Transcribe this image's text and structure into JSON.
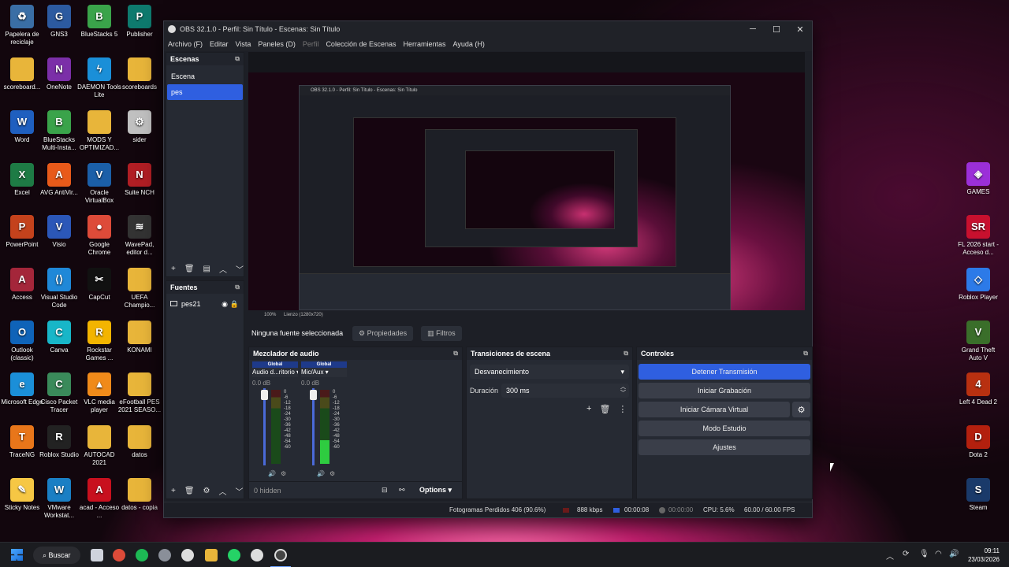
{
  "desktop_left": [
    {
      "label": "Papelera de reciclaje",
      "icon": "recycle-bin-icon",
      "color": "#3a6ea5",
      "glyph": "♻"
    },
    {
      "label": "GNS3",
      "icon": "gns3-icon",
      "color": "#2c5aa0",
      "glyph": "G"
    },
    {
      "label": "BlueStacks 5",
      "icon": "bluestacks-icon",
      "color": "#3aa34a",
      "glyph": "B"
    },
    {
      "label": "Publisher",
      "icon": "publisher-icon",
      "color": "#0e7a6e",
      "glyph": "P"
    },
    {
      "label": "scoreboard...",
      "icon": "folder-icon",
      "color": "#e8b53a",
      "glyph": ""
    },
    {
      "label": "OneNote",
      "icon": "onenote-icon",
      "color": "#7b2fa8",
      "glyph": "N"
    },
    {
      "label": "DAEMON Tools Lite",
      "icon": "daemon-tools-icon",
      "color": "#1a8fd8",
      "glyph": "ϟ"
    },
    {
      "label": "scoreboards",
      "icon": "folder-icon",
      "color": "#e8b53a",
      "glyph": ""
    },
    {
      "label": "Word",
      "icon": "word-icon",
      "color": "#1f5fbf",
      "glyph": "W"
    },
    {
      "label": "BlueStacks Multi-Insta...",
      "icon": "bluestacks-multi-icon",
      "color": "#3aa34a",
      "glyph": "B"
    },
    {
      "label": "MODS Y OPTIMIZAD...",
      "icon": "folder-icon",
      "color": "#e8b53a",
      "glyph": ""
    },
    {
      "label": "sider",
      "icon": "sider-gear-icon",
      "color": "#c0c0c0",
      "glyph": "⚙"
    },
    {
      "label": "Excel",
      "icon": "excel-icon",
      "color": "#1e7b45",
      "glyph": "X"
    },
    {
      "label": "AVG AntiVir...",
      "icon": "avg-icon",
      "color": "#e85a1a",
      "glyph": "A"
    },
    {
      "label": "Oracle VirtualBox",
      "icon": "virtualbox-icon",
      "color": "#1b5fa8",
      "glyph": "V"
    },
    {
      "label": "Suite NCH",
      "icon": "nch-suite-icon",
      "color": "#b01e24",
      "glyph": "N"
    },
    {
      "label": "PowerPoint",
      "icon": "powerpoint-icon",
      "color": "#c4421c",
      "glyph": "P"
    },
    {
      "label": "Visio",
      "icon": "visio-icon",
      "color": "#2b57b8",
      "glyph": "V"
    },
    {
      "label": "Google Chrome",
      "icon": "chrome-icon",
      "color": "#dd4b39",
      "glyph": "●"
    },
    {
      "label": "WavePad, editor d...",
      "icon": "wavepad-icon",
      "color": "#333333",
      "glyph": "≋"
    },
    {
      "label": "Access",
      "icon": "access-icon",
      "color": "#a4263a",
      "glyph": "A"
    },
    {
      "label": "Visual Studio Code",
      "icon": "vscode-icon",
      "color": "#1f88d8",
      "glyph": "⟨⟩"
    },
    {
      "label": "CapCut",
      "icon": "capcut-icon",
      "color": "#111111",
      "glyph": "✂"
    },
    {
      "label": "UEFA Champio...",
      "icon": "folder-icon",
      "color": "#e8b53a",
      "glyph": ""
    },
    {
      "label": "Outlook (classic)",
      "icon": "outlook-icon",
      "color": "#0f63b8",
      "glyph": "O"
    },
    {
      "label": "Canva",
      "icon": "canva-icon",
      "color": "#18b6c8",
      "glyph": "C"
    },
    {
      "label": "Rockstar Games ...",
      "icon": "rockstar-icon",
      "color": "#f3b400",
      "glyph": "R"
    },
    {
      "label": "KONAMI",
      "icon": "folder-icon",
      "color": "#e8b53a",
      "glyph": ""
    },
    {
      "label": "Microsoft Edge",
      "icon": "edge-icon",
      "color": "#1b8fd8",
      "glyph": "e"
    },
    {
      "label": "Cisco Packet Tracer",
      "icon": "packet-tracer-icon",
      "color": "#3a8a5a",
      "glyph": "C"
    },
    {
      "label": "VLC media player",
      "icon": "vlc-icon",
      "color": "#f08a1a",
      "glyph": "▲"
    },
    {
      "label": "eFootball PES 2021 SEASO...",
      "icon": "folder-icon",
      "color": "#e8b53a",
      "glyph": ""
    },
    {
      "label": "TraceNG",
      "icon": "traceng-icon",
      "color": "#e8761a",
      "glyph": "T"
    },
    {
      "label": "Roblox Studio",
      "icon": "roblox-studio-icon",
      "color": "#222222",
      "glyph": "R"
    },
    {
      "label": "AUTOCAD 2021",
      "icon": "folder-icon",
      "color": "#e8b53a",
      "glyph": ""
    },
    {
      "label": "datos",
      "icon": "folder-icon",
      "color": "#e8b53a",
      "glyph": ""
    },
    {
      "label": "Sticky Notes",
      "icon": "sticky-notes-icon",
      "color": "#f6c744",
      "glyph": "✎"
    },
    {
      "label": "VMware Workstat...",
      "icon": "vmware-icon",
      "color": "#1a7fc4",
      "glyph": "W"
    },
    {
      "label": "acad - Acceso ...",
      "icon": "autocad-icon",
      "color": "#c8101e",
      "glyph": "A"
    },
    {
      "label": "datos - copia",
      "icon": "folder-icon",
      "color": "#e8b53a",
      "glyph": ""
    }
  ],
  "desktop_right": [
    {
      "label": "GAMES",
      "icon": "gamepad-icon",
      "color": "#9b2fd8",
      "glyph": "◈"
    },
    {
      "label": "FL 2026 start - Acceso d...",
      "icon": "fl-studio-icon",
      "color": "#c8102e",
      "glyph": "SR"
    },
    {
      "label": "Roblox Player",
      "icon": "roblox-icon",
      "color": "#2c7ae8",
      "glyph": "◇"
    },
    {
      "label": "Grand Theft Auto V",
      "icon": "gta-icon",
      "color": "#3a6e2a",
      "glyph": "V"
    },
    {
      "label": "Left 4 Dead 2",
      "icon": "left4dead-icon",
      "color": "#b83010",
      "glyph": "4"
    },
    {
      "label": "Dota 2",
      "icon": "dota-icon",
      "color": "#b3200e",
      "glyph": "D"
    },
    {
      "label": "Steam",
      "icon": "steam-icon",
      "color": "#1a3a6a",
      "glyph": "S"
    }
  ],
  "window": {
    "title": "OBS 32.1.0 - Perfil: Sin Título - Escenas: Sin Título",
    "controls": {
      "minimize": "─",
      "maximize": "☐",
      "close": "✕"
    },
    "menu": [
      "Archivo (F)",
      "Editar",
      "Vista",
      "Paneles (D)",
      "Perfil",
      "Colección de Escenas",
      "Herramientas",
      "Ayuda (H)"
    ]
  },
  "scenes": {
    "title": "Escenas",
    "items": [
      "Escena",
      "pes"
    ],
    "selected": 1
  },
  "sources": {
    "title": "Fuentes",
    "items": [
      "pes21"
    ]
  },
  "preview": {
    "zoom": "100%",
    "canvas": "Lienzo (1280x720)"
  },
  "context_bar": {
    "no_source": "Ninguna fuente seleccionada",
    "properties": "Propiedades",
    "filters": "Filtros"
  },
  "audio": {
    "title": "Mezclador de audio",
    "channels": [
      {
        "badge": "Global",
        "name": "Audio d...ritorio",
        "db": "0.0 dB",
        "level": 0.0
      },
      {
        "badge": "Global",
        "name": "Mic/Aux",
        "db": "0.0 dB",
        "level": 0.32
      }
    ],
    "ticks": [
      "0",
      "-6",
      "-12",
      "-18",
      "-24",
      "-30",
      "-36",
      "-42",
      "-48",
      "-54",
      "-60"
    ],
    "hidden": "0 hidden",
    "options": "Options"
  },
  "transitions": {
    "title": "Transiciones de escena",
    "type": "Desvanecimiento",
    "duration_label": "Duración",
    "duration": "300 ms"
  },
  "controls": {
    "title": "Controles",
    "buttons": [
      "Detener Transmisión",
      "Iniciar Grabación",
      "Iniciar Cámara Virtual",
      "Modo Estudio",
      "Ajustes"
    ]
  },
  "status": {
    "dropped": "Fotogramas Perdidos 406 (90.6%)",
    "bitrate": "888 kbps",
    "stream_time": "00:00:08",
    "rec_time": "00:00:00",
    "cpu": "CPU: 5.6%",
    "fps": "60.00 / 60.00 FPS"
  },
  "taskbar": {
    "search": "Buscar",
    "time": "09:11",
    "date": "23/03/2026"
  }
}
